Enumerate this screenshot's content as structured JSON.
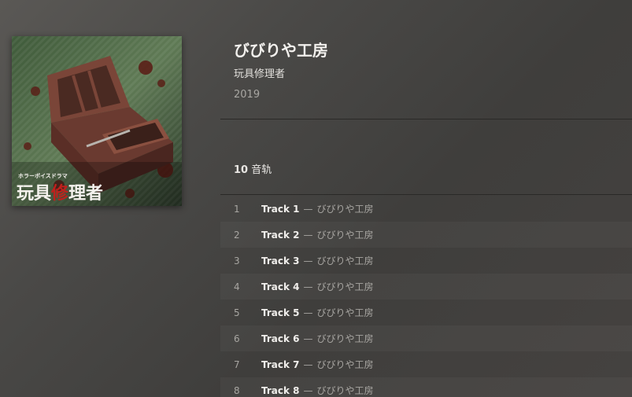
{
  "album": {
    "title": "びびりや工房",
    "subtitle": "玩具修理者",
    "year": "2019",
    "cover": {
      "caption_small": "ホラーボイスドラマ",
      "caption_large_1": "玩具",
      "caption_large_2": "修",
      "caption_large_3": "理者"
    }
  },
  "tracklist": {
    "count": "10",
    "count_label": "音轨",
    "separator": "—",
    "tracks": [
      {
        "num": "1",
        "title": "Track 1",
        "artist": "びびりや工房"
      },
      {
        "num": "2",
        "title": "Track 2",
        "artist": "びびりや工房"
      },
      {
        "num": "3",
        "title": "Track 3",
        "artist": "びびりや工房"
      },
      {
        "num": "4",
        "title": "Track 4",
        "artist": "びびりや工房"
      },
      {
        "num": "5",
        "title": "Track 5",
        "artist": "びびりや工房"
      },
      {
        "num": "6",
        "title": "Track 6",
        "artist": "びびりや工房"
      },
      {
        "num": "7",
        "title": "Track 7",
        "artist": "びびりや工房"
      },
      {
        "num": "8",
        "title": "Track 8",
        "artist": "びびりや工房"
      }
    ]
  }
}
